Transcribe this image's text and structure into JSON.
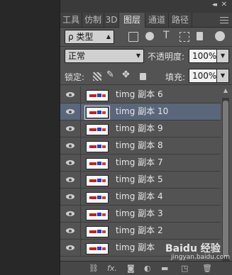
{
  "tabs": [
    "工具",
    "仿制",
    "3D",
    "图层",
    "通道",
    "路径"
  ],
  "active_tab": "图层",
  "filter": {
    "label": "ρ 类型"
  },
  "blend_mode": "正常",
  "opacity": {
    "label": "不透明度:",
    "value": "100%"
  },
  "lock": {
    "label": "锁定:"
  },
  "fill": {
    "label": "填充:",
    "value": "100%"
  },
  "layers": [
    {
      "name": "timg 副本 6"
    },
    {
      "name": "timg 副本 10"
    },
    {
      "name": "timg 副本 9"
    },
    {
      "name": "timg 副本 8"
    },
    {
      "name": "timg 副本 7"
    },
    {
      "name": "timg 副本 5"
    },
    {
      "name": "timg 副本 4"
    },
    {
      "name": "timg 副本 3"
    },
    {
      "name": "timg 副本 2"
    },
    {
      "name": "timg 副本"
    }
  ],
  "selected_layer": "timg 副本 10",
  "watermark": {
    "main": "Baidu 经验",
    "sub": "jingyan.baidu.com"
  },
  "colors": {
    "panel": "#535353",
    "selected": "#5a677a",
    "dark": "#282828"
  }
}
